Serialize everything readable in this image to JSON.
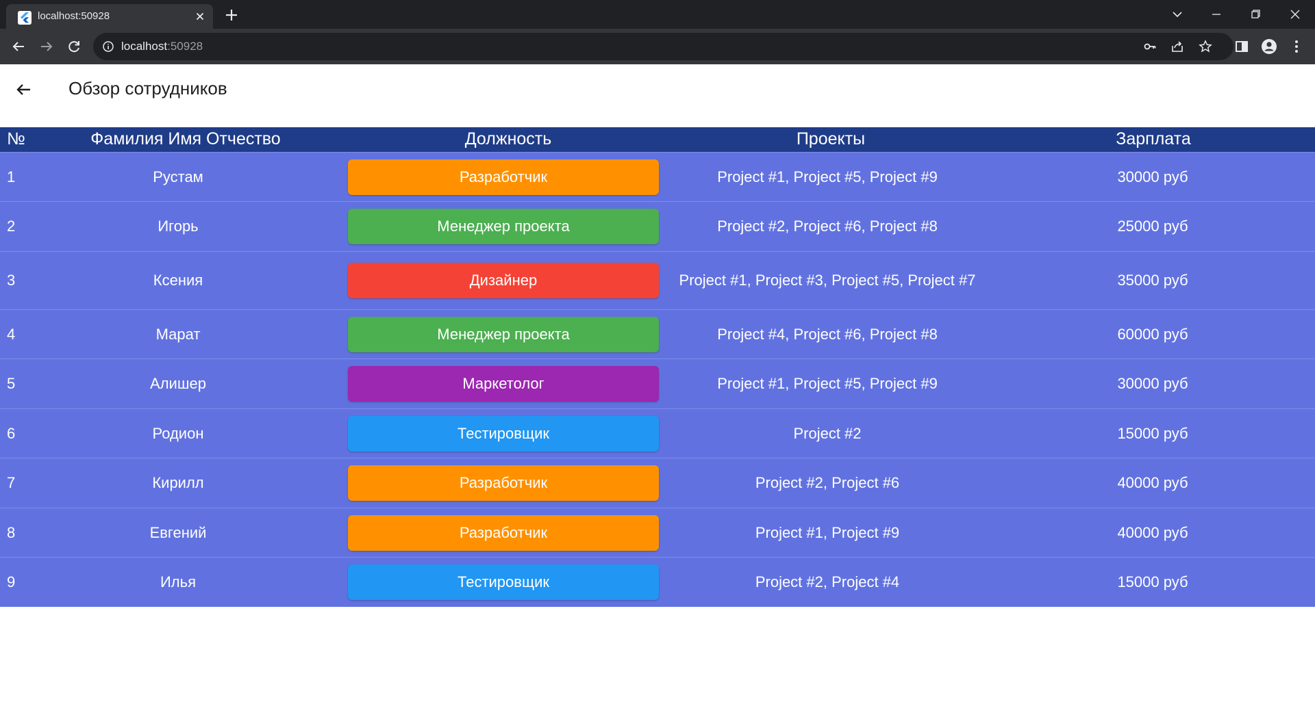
{
  "browser": {
    "tab_title": "localhost:50928",
    "url_host": "localhost",
    "url_port": ":50928",
    "icons": [
      "flutter-favicon",
      "close-icon",
      "plus-icon",
      "chevron-down-icon",
      "minimize-icon",
      "restore-icon",
      "close-icon",
      "back-arrow-icon",
      "forward-arrow-icon",
      "reload-icon",
      "info-icon",
      "key-icon",
      "share-icon",
      "star-icon",
      "side-panel-icon",
      "profile-icon",
      "kebab-menu-icon"
    ]
  },
  "app": {
    "title": "Обзор сотрудников",
    "back_icon": "arrow-left-icon"
  },
  "table": {
    "headers": {
      "num": "№",
      "name": "Фамилия Имя Отчество",
      "role": "Должность",
      "projects": "Проекты",
      "salary": "Зарплата"
    },
    "rows": [
      {
        "num": "1",
        "name": "Рустам",
        "role": "Разработчик",
        "role_color": "#ff9100",
        "projects": "Project #1, Project #5, Project #9",
        "salary": "30000 руб"
      },
      {
        "num": "2",
        "name": "Игорь",
        "role": "Менеджер проекта",
        "role_color": "#4caf50",
        "projects": "Project #2, Project #6, Project #8",
        "salary": "25000 руб"
      },
      {
        "num": "3",
        "name": "Ксения",
        "role": "Дизайнер",
        "role_color": "#f44336",
        "projects": "Project #1, Project #3, Project #5, Project #7",
        "salary": "35000 руб"
      },
      {
        "num": "4",
        "name": "Марат",
        "role": "Менеджер проекта",
        "role_color": "#4caf50",
        "projects": "Project #4, Project #6, Project #8",
        "salary": "60000 руб"
      },
      {
        "num": "5",
        "name": "Алишер",
        "role": "Маркетолог",
        "role_color": "#9c27b0",
        "projects": "Project #1, Project #5, Project #9",
        "salary": "30000 руб"
      },
      {
        "num": "6",
        "name": "Родион",
        "role": "Тестировщик",
        "role_color": "#2196f3",
        "projects": "Project #2",
        "salary": "15000 руб"
      },
      {
        "num": "7",
        "name": "Кирилл",
        "role": "Разработчик",
        "role_color": "#ff9100",
        "projects": "Project #2, Project #6",
        "salary": "40000 руб"
      },
      {
        "num": "8",
        "name": "Евгений",
        "role": "Разработчик",
        "role_color": "#ff9100",
        "projects": "Project #1, Project #9",
        "salary": "40000 руб"
      },
      {
        "num": "9",
        "name": "Илья",
        "role": "Тестировщик",
        "role_color": "#2196f3",
        "projects": "Project #2, Project #4",
        "salary": "15000 руб"
      }
    ]
  },
  "colors": {
    "header_bg": "#1f3c88",
    "row_bg": "#6172e0",
    "row_divider": "#7e8cea"
  }
}
